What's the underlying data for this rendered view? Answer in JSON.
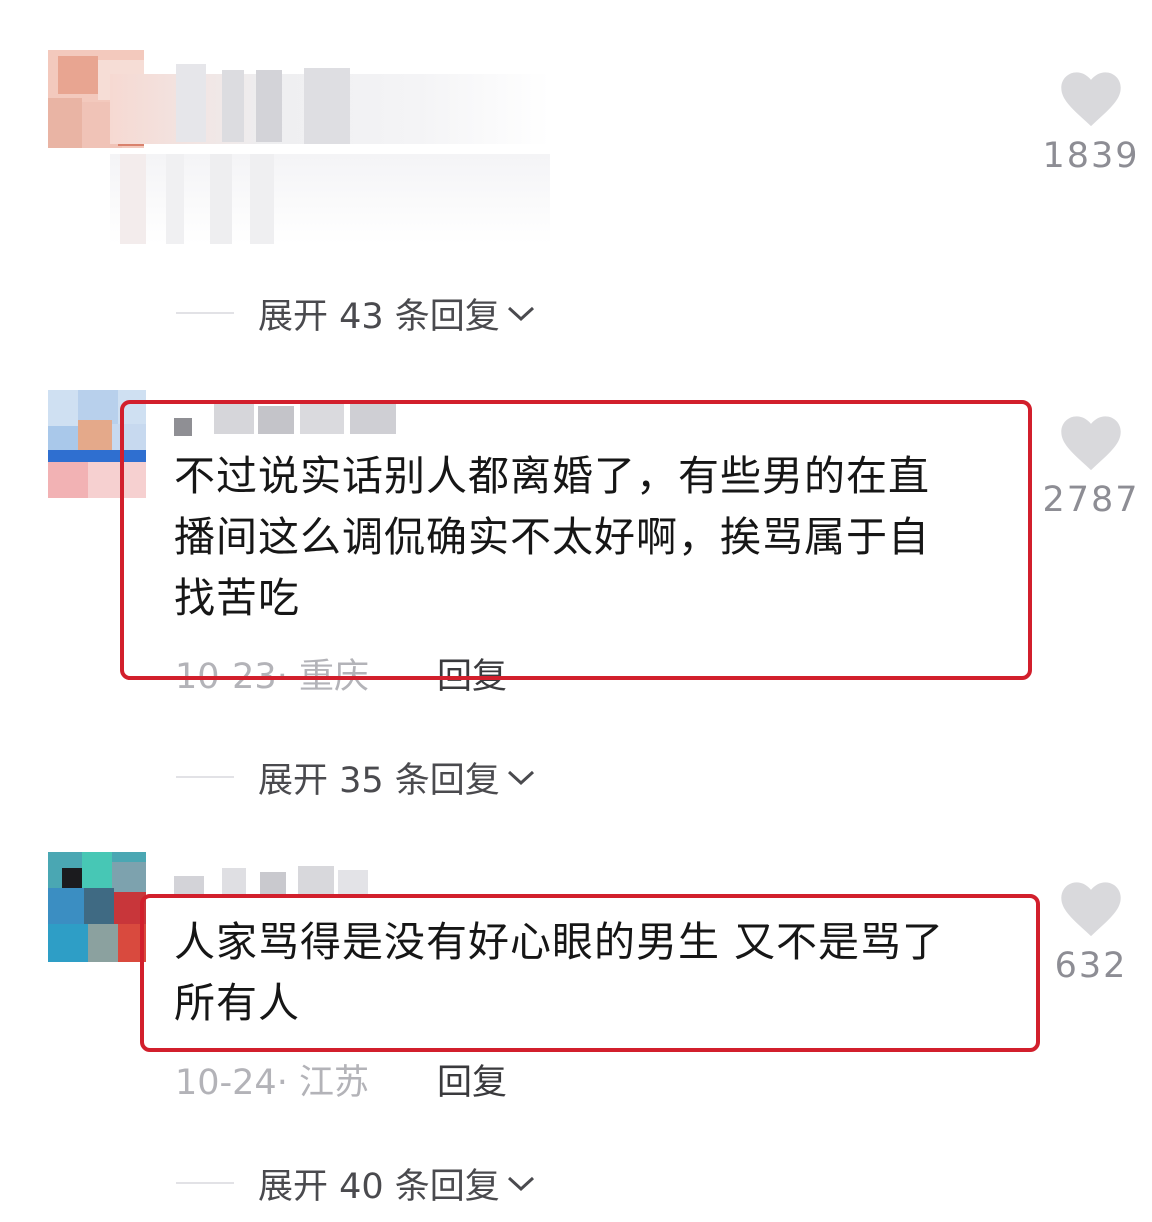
{
  "comments": [
    {
      "text_lines": [],
      "likes": "1839",
      "expand_label": "展开 43 条回复"
    },
    {
      "text_lines": [
        "不过说实话别人都离婚了，有些男的在直",
        "播间这么调侃确实不太好啊，挨骂属于自",
        "找苦吃"
      ],
      "date_location": "10-23· 重庆",
      "reply_label": "回复",
      "likes": "2787",
      "expand_label": "展开 35 条回复"
    },
    {
      "text_lines": [
        "人家骂得是没有好心眼的男生 又不是骂了",
        "所有人"
      ],
      "date_location": "10-24· 江苏",
      "reply_label": "回复",
      "likes": "632",
      "expand_label": "展开 40 条回复"
    }
  ],
  "icons": {
    "like": "heart-icon",
    "expand": "chevron-down-icon"
  },
  "colors": {
    "highlight": "#d21f2c",
    "heart": "#d9d9dc",
    "secondary_text": "#8d8d94"
  }
}
